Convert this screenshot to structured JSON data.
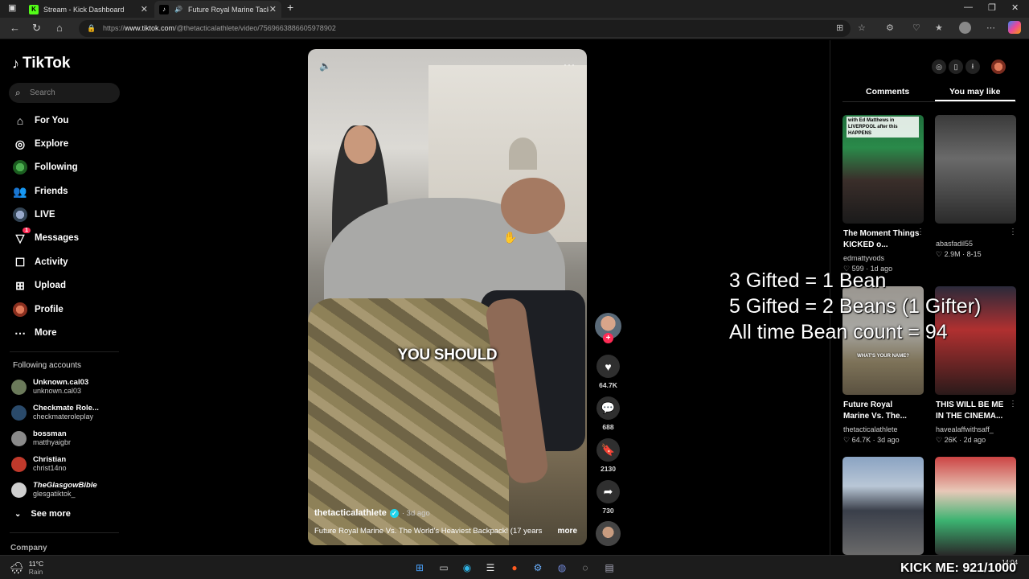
{
  "browser": {
    "tabs": [
      {
        "label": "Stream - Kick Dashboard",
        "icon": "kick-logo-icon"
      },
      {
        "label": "Future Royal Marine Tackles",
        "icon": "tiktok-logo-icon"
      }
    ],
    "new_tab": "+",
    "url_prefix": "https://",
    "url_host": "www.tiktok.com",
    "url_path": "/@thetacticalathlete/video/7569663886605978902"
  },
  "sidebar": {
    "logo": "TikTok",
    "search_placeholder": "Search",
    "nav": [
      {
        "label": "For You",
        "icon": "home-icon"
      },
      {
        "label": "Explore",
        "icon": "compass-icon"
      },
      {
        "label": "Following",
        "icon": "following-avatar-icon"
      },
      {
        "label": "Friends",
        "icon": "friends-icon"
      },
      {
        "label": "LIVE",
        "icon": "live-icon"
      },
      {
        "label": "Messages",
        "icon": "messages-icon",
        "badge": "1"
      },
      {
        "label": "Activity",
        "icon": "activity-icon"
      },
      {
        "label": "Upload",
        "icon": "upload-icon"
      },
      {
        "label": "Profile",
        "icon": "profile-avatar-icon"
      },
      {
        "label": "More",
        "icon": "more-icon"
      }
    ],
    "following_title": "Following accounts",
    "following": [
      {
        "name": "Unknown.cal03",
        "user": "unknown.cal03",
        "color": "#6b7a5a"
      },
      {
        "name": "Checkmate Role...",
        "user": "checkmateroleplay",
        "color": "#2a4a6a"
      },
      {
        "name": "bossman",
        "user": "matthyaigbr",
        "color": "#8a8a8a"
      },
      {
        "name": "Christian",
        "user": "christ14no",
        "color": "#c0392b"
      },
      {
        "name": "TheGlasgowBible",
        "user": "glesgatiktok_",
        "color": "#cfcfcf"
      }
    ],
    "see_more": "See more",
    "company": "Company"
  },
  "video": {
    "caption_overlay": "YOU SHOULD",
    "username": "thetacticalathlete",
    "posted": "· 3d ago",
    "description": "Future Royal Marine Vs. The World's Heaviest Backpack! (17 years",
    "more": "more",
    "likes": "64.7K",
    "comments": "688",
    "saves": "2130",
    "shares": "730"
  },
  "panel": {
    "tab_comments": "Comments",
    "tab_you_may_like": "You may like",
    "recs": [
      {
        "title": "The Moment Things KICKED o...",
        "author": "edmattyvods",
        "stats": "♡ 599 · 1d ago",
        "thumb_text": "with Ed Matthews in LIVERPOOL after this HAPPENS"
      },
      {
        "title": "",
        "author": "abasfadil55",
        "stats": "♡ 2.9M · 8-15",
        "thumb_text": ""
      },
      {
        "title": "Future Royal Marine Vs. The...",
        "author": "thetacticalathlete",
        "stats": "♡ 64.7K · 3d ago",
        "thumb_text": "WHAT'S YOUR NAME?"
      },
      {
        "title": "THIS WILL BE ME IN THE CINEMA...",
        "author": "havealaffwithsaff_",
        "stats": "♡ 26K · 2d ago",
        "thumb_text": ""
      },
      {
        "title": "",
        "author": "",
        "stats": "",
        "thumb_text": ""
      },
      {
        "title": "",
        "author": "",
        "stats": "",
        "thumb_text": ""
      }
    ]
  },
  "overlay": {
    "line1": "3 Gifted = 1 Bean",
    "line2": "5 Gifted = 2 Beans (1 Gifter)",
    "line3": "All time Bean count = 94",
    "kick_counter": "KICK ME: 921/1000"
  },
  "taskbar": {
    "temp": "11°C",
    "weather": "Rain",
    "time": "14:04"
  }
}
